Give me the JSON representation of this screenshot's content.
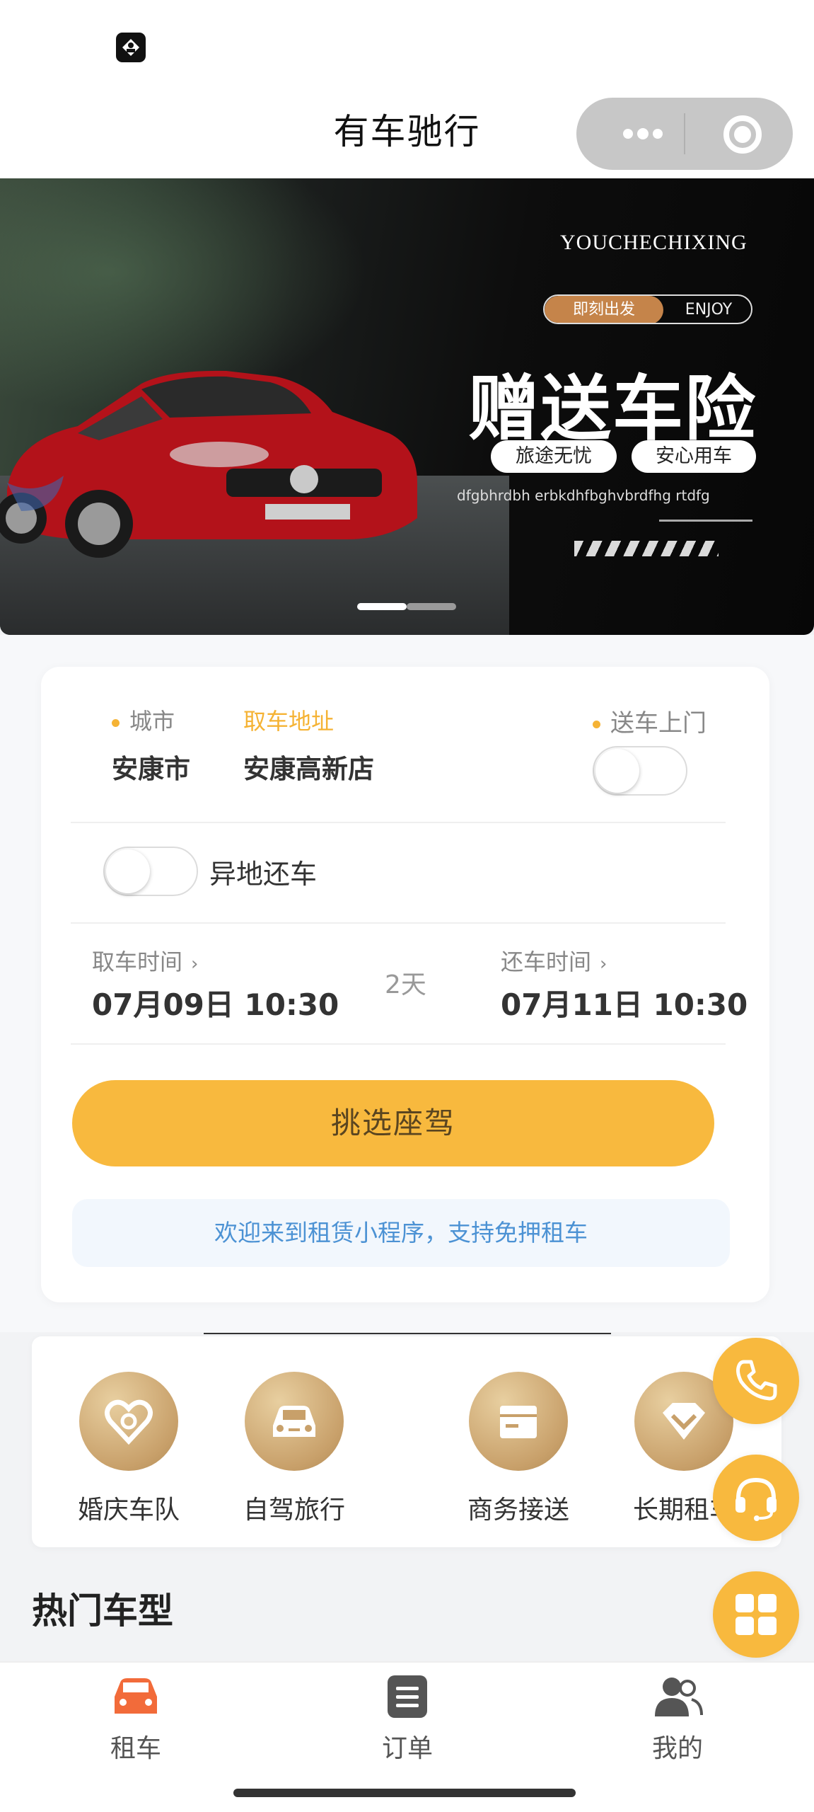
{
  "nav": {
    "title": "有车驰行"
  },
  "banner": {
    "brand": "YOUCHECHIXING",
    "pill_left": "即刻出发",
    "pill_right": "ENJOY",
    "headline": "赠送车险",
    "tag1": "旅途无忧",
    "tag2": "安心用车",
    "subtext": "dfgbhrdbh erbkdhfbghvbrdfhg rtdfg",
    "slide_count": 2,
    "active_slide": 1
  },
  "booking": {
    "city_label": "城市",
    "city_value": "安康市",
    "address_label": "取车地址",
    "address_value": "安康高新店",
    "delivery_label": "送车上门",
    "delivery_enabled": false,
    "return_elsewhere_label": "异地还车",
    "return_elsewhere_enabled": false,
    "pickup_label": "取车时间",
    "pickup_value": "07月09日 10:30",
    "duration": "2天",
    "return_label": "还车时间",
    "return_value": "07月11日 10:30",
    "select_button": "挑选座驾",
    "notice": "欢迎来到租赁小程序，支持免押租车"
  },
  "services": [
    {
      "label": "婚庆车队",
      "icon": "heart-ring-icon"
    },
    {
      "label": "自驾旅行",
      "icon": "car-icon"
    },
    {
      "label": "商务接送",
      "icon": "box-icon"
    },
    {
      "label": "长期租车",
      "icon": "diamond-icon"
    }
  ],
  "hot_models_title": "热门车型",
  "tabs": [
    {
      "label": "租车",
      "icon": "car-icon",
      "active": true
    },
    {
      "label": "订单",
      "icon": "list-icon",
      "active": false
    },
    {
      "label": "我的",
      "icon": "users-icon",
      "active": false
    }
  ],
  "colors": {
    "accent": "#f8b93e",
    "active_tab": "#f26b3a",
    "notice_text": "#4c92d4"
  }
}
